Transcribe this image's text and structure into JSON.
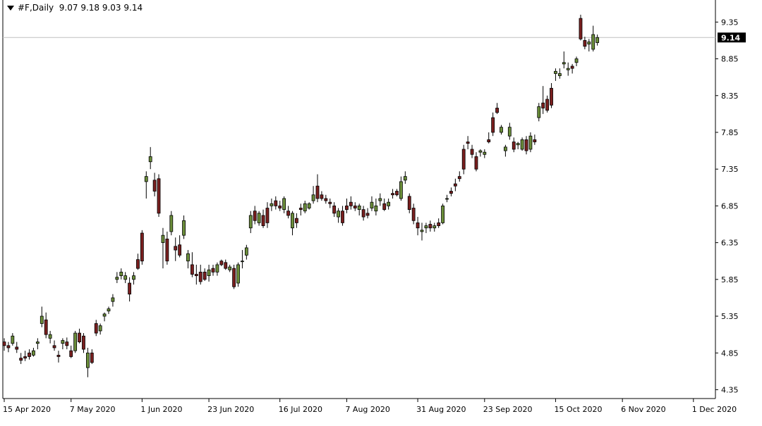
{
  "header": {
    "symbol": "#F,Daily",
    "ohlc": "9.07 9.18 9.03 9.14"
  },
  "colors": {
    "bull": "#6b8e3a",
    "bear": "#7a1f1f",
    "wick": "#000000",
    "grid_line": "#c0c0c0",
    "price_label_bg": "#000000",
    "price_label_fg": "#ffffff"
  },
  "chart_data": {
    "type": "candlestick",
    "title": "#F,Daily",
    "y_ticks": [
      4.35,
      4.85,
      5.35,
      5.85,
      6.35,
      6.85,
      7.35,
      7.85,
      8.35,
      8.85,
      9.35
    ],
    "y_tick_labels": [
      "4.35",
      "4.85",
      "5.35",
      "5.85",
      "6.35",
      "6.85",
      "7.35",
      "7.85",
      "8.35",
      "8.85",
      "9.35"
    ],
    "ylim": [
      4.23,
      9.65
    ],
    "x_tick_labels": [
      "15 Apr 2020",
      "7 May 2020",
      "1 Jun 2020",
      "23 Jun 2020",
      "16 Jul 2020",
      "7 Aug 2020",
      "31 Aug 2020",
      "23 Sep 2020",
      "15 Oct 2020",
      "6 Nov 2020",
      "1 Dec 2020"
    ],
    "x_tick_index": [
      0,
      16,
      33,
      49,
      66,
      82,
      99,
      115,
      132,
      148,
      165
    ],
    "last_price": 9.14,
    "last_price_label": "9.14",
    "candles": [
      [
        5.0,
        5.05,
        4.88,
        4.95
      ],
      [
        4.95,
        5.0,
        4.86,
        4.92
      ],
      [
        4.98,
        5.12,
        4.95,
        5.08
      ],
      [
        4.93,
        5.0,
        4.85,
        4.9
      ],
      [
        4.78,
        4.85,
        4.7,
        4.75
      ],
      [
        4.8,
        4.88,
        4.74,
        4.78
      ],
      [
        4.85,
        4.9,
        4.76,
        4.8
      ],
      [
        4.82,
        4.92,
        4.8,
        4.88
      ],
      [
        4.98,
        5.05,
        4.9,
        5.0
      ],
      [
        5.25,
        5.48,
        5.2,
        5.35
      ],
      [
        5.3,
        5.4,
        5.05,
        5.1
      ],
      [
        5.05,
        5.15,
        4.98,
        5.1
      ],
      [
        4.95,
        5.02,
        4.88,
        4.92
      ],
      [
        4.82,
        4.88,
        4.72,
        4.8
      ],
      [
        4.98,
        5.05,
        4.9,
        5.02
      ],
      [
        5.0,
        5.06,
        4.9,
        4.95
      ],
      [
        4.88,
        4.95,
        4.78,
        4.8
      ],
      [
        4.88,
        5.15,
        4.85,
        5.12
      ],
      [
        5.12,
        5.18,
        4.98,
        5.0
      ],
      [
        5.08,
        5.12,
        4.85,
        4.9
      ],
      [
        4.65,
        4.92,
        4.52,
        4.85
      ],
      [
        4.85,
        4.9,
        4.7,
        4.72
      ],
      [
        5.25,
        5.3,
        5.08,
        5.12
      ],
      [
        5.15,
        5.25,
        5.1,
        5.22
      ],
      [
        5.35,
        5.4,
        5.28,
        5.38
      ],
      [
        5.42,
        5.48,
        5.38,
        5.45
      ],
      [
        5.55,
        5.65,
        5.48,
        5.6
      ],
      [
        5.85,
        5.95,
        5.8,
        5.88
      ],
      [
        5.9,
        6.0,
        5.85,
        5.95
      ],
      [
        5.85,
        5.95,
        5.8,
        5.9
      ],
      [
        5.8,
        5.88,
        5.55,
        5.65
      ],
      [
        5.85,
        5.95,
        5.78,
        5.9
      ],
      [
        6.12,
        6.2,
        5.98,
        6.0
      ],
      [
        6.48,
        6.52,
        6.05,
        6.1
      ],
      [
        7.18,
        7.32,
        6.95,
        7.25
      ],
      [
        7.45,
        7.65,
        7.35,
        7.52
      ],
      [
        7.2,
        7.3,
        6.98,
        7.05
      ],
      [
        7.22,
        7.28,
        6.7,
        6.75
      ],
      [
        6.35,
        6.55,
        6.0,
        6.45
      ],
      [
        6.4,
        6.5,
        6.05,
        6.1
      ],
      [
        6.5,
        6.78,
        6.45,
        6.72
      ],
      [
        6.3,
        6.42,
        6.1,
        6.25
      ],
      [
        6.32,
        6.45,
        6.15,
        6.18
      ],
      [
        6.45,
        6.72,
        6.4,
        6.65
      ],
      [
        6.1,
        6.25,
        6.0,
        6.2
      ],
      [
        6.05,
        6.22,
        5.88,
        5.92
      ],
      [
        5.92,
        6.05,
        5.78,
        5.9
      ],
      [
        5.95,
        6.05,
        5.78,
        5.82
      ],
      [
        5.95,
        6.0,
        5.83,
        5.85
      ],
      [
        5.9,
        6.05,
        5.82,
        5.98
      ],
      [
        6.0,
        6.05,
        5.9,
        5.95
      ],
      [
        5.95,
        6.08,
        5.9,
        6.05
      ],
      [
        6.1,
        6.12,
        6.03,
        6.05
      ],
      [
        6.08,
        6.12,
        5.98,
        6.0
      ],
      [
        5.98,
        6.05,
        5.95,
        6.02
      ],
      [
        6.0,
        6.05,
        5.72,
        5.75
      ],
      [
        5.8,
        6.08,
        5.75,
        6.05
      ],
      [
        6.1,
        6.25,
        6.0,
        6.1
      ],
      [
        6.18,
        6.32,
        6.12,
        6.28
      ],
      [
        6.55,
        6.78,
        6.48,
        6.72
      ],
      [
        6.78,
        6.85,
        6.6,
        6.65
      ],
      [
        6.62,
        6.78,
        6.58,
        6.75
      ],
      [
        6.72,
        6.8,
        6.55,
        6.58
      ],
      [
        6.82,
        6.9,
        6.55,
        6.62
      ],
      [
        6.85,
        6.95,
        6.78,
        6.88
      ],
      [
        6.92,
        6.98,
        6.8,
        6.85
      ],
      [
        6.85,
        6.92,
        6.78,
        6.82
      ],
      [
        6.8,
        6.98,
        6.75,
        6.95
      ],
      [
        6.78,
        6.85,
        6.68,
        6.72
      ],
      [
        6.55,
        6.78,
        6.45,
        6.75
      ],
      [
        6.68,
        6.75,
        6.55,
        6.62
      ],
      [
        6.82,
        6.88,
        6.72,
        6.8
      ],
      [
        6.78,
        6.92,
        6.75,
        6.88
      ],
      [
        6.82,
        6.9,
        6.8,
        6.88
      ],
      [
        6.92,
        7.12,
        6.88,
        7.0
      ],
      [
        7.12,
        7.28,
        6.9,
        6.95
      ],
      [
        7.0,
        7.05,
        6.92,
        6.95
      ],
      [
        6.95,
        7.0,
        6.88,
        6.92
      ],
      [
        6.9,
        6.95,
        6.82,
        6.88
      ],
      [
        6.85,
        6.9,
        6.7,
        6.75
      ],
      [
        6.7,
        6.82,
        6.62,
        6.78
      ],
      [
        6.78,
        6.85,
        6.58,
        6.62
      ],
      [
        6.85,
        6.95,
        6.75,
        6.8
      ],
      [
        6.9,
        6.98,
        6.8,
        6.85
      ],
      [
        6.85,
        6.9,
        6.78,
        6.82
      ],
      [
        6.8,
        6.88,
        6.72,
        6.85
      ],
      [
        6.8,
        6.85,
        6.65,
        6.7
      ],
      [
        6.75,
        6.82,
        6.68,
        6.72
      ],
      [
        6.82,
        6.98,
        6.78,
        6.9
      ],
      [
        6.78,
        6.95,
        6.72,
        6.85
      ],
      [
        6.92,
        7.02,
        6.85,
        6.95
      ],
      [
        6.88,
        6.95,
        6.78,
        6.8
      ],
      [
        6.85,
        6.95,
        6.8,
        6.9
      ],
      [
        7.02,
        7.08,
        6.95,
        7.0
      ],
      [
        7.05,
        7.08,
        6.98,
        7.0
      ],
      [
        6.95,
        7.25,
        6.92,
        7.18
      ],
      [
        7.2,
        7.32,
        7.15,
        7.25
      ],
      [
        6.98,
        7.02,
        6.75,
        6.8
      ],
      [
        6.82,
        6.88,
        6.6,
        6.65
      ],
      [
        6.62,
        6.7,
        6.45,
        6.55
      ],
      [
        6.5,
        6.62,
        6.38,
        6.52
      ],
      [
        6.55,
        6.62,
        6.48,
        6.58
      ],
      [
        6.6,
        6.65,
        6.5,
        6.55
      ],
      [
        6.55,
        6.62,
        6.5,
        6.58
      ],
      [
        6.62,
        6.68,
        6.55,
        6.58
      ],
      [
        6.62,
        6.88,
        6.6,
        6.85
      ],
      [
        6.95,
        7.0,
        6.9,
        6.95
      ],
      [
        7.05,
        7.1,
        6.98,
        7.02
      ],
      [
        7.15,
        7.22,
        7.05,
        7.12
      ],
      [
        7.25,
        7.32,
        7.18,
        7.22
      ],
      [
        7.62,
        7.68,
        7.28,
        7.35
      ],
      [
        7.72,
        7.8,
        7.62,
        7.7
      ],
      [
        7.62,
        7.68,
        7.5,
        7.55
      ],
      [
        7.52,
        7.58,
        7.32,
        7.35
      ],
      [
        7.58,
        7.62,
        7.52,
        7.6
      ],
      [
        7.55,
        7.62,
        7.5,
        7.58
      ],
      [
        7.75,
        7.85,
        7.7,
        7.72
      ],
      [
        8.05,
        8.12,
        7.8,
        7.85
      ],
      [
        8.18,
        8.25,
        8.1,
        8.12
      ],
      [
        7.85,
        7.95,
        7.82,
        7.92
      ],
      [
        7.6,
        7.68,
        7.52,
        7.65
      ],
      [
        7.8,
        7.98,
        7.75,
        7.92
      ],
      [
        7.72,
        7.78,
        7.58,
        7.62
      ],
      [
        7.68,
        7.72,
        7.62,
        7.7
      ],
      [
        7.62,
        7.78,
        7.6,
        7.75
      ],
      [
        7.75,
        7.8,
        7.55,
        7.6
      ],
      [
        7.62,
        7.85,
        7.58,
        7.8
      ],
      [
        7.75,
        7.82,
        7.68,
        7.72
      ],
      [
        8.05,
        8.25,
        8.0,
        8.2
      ],
      [
        8.25,
        8.48,
        8.1,
        8.18
      ],
      [
        8.3,
        8.35,
        8.12,
        8.15
      ],
      [
        8.45,
        8.52,
        8.18,
        8.22
      ],
      [
        8.65,
        8.72,
        8.55,
        8.68
      ],
      [
        8.62,
        8.72,
        8.58,
        8.65
      ],
      [
        8.78,
        8.95,
        8.72,
        8.8
      ],
      [
        8.7,
        8.8,
        8.62,
        8.72
      ],
      [
        8.75,
        8.78,
        8.65,
        8.72
      ],
      [
        8.8,
        8.88,
        8.75,
        8.85
      ],
      [
        9.4,
        9.45,
        9.1,
        9.12
      ],
      [
        9.1,
        9.15,
        8.98,
        9.02
      ],
      [
        9.05,
        9.12,
        8.95,
        9.08
      ],
      [
        8.98,
        9.3,
        8.95,
        9.18
      ],
      [
        9.07,
        9.18,
        9.03,
        9.14
      ]
    ]
  }
}
